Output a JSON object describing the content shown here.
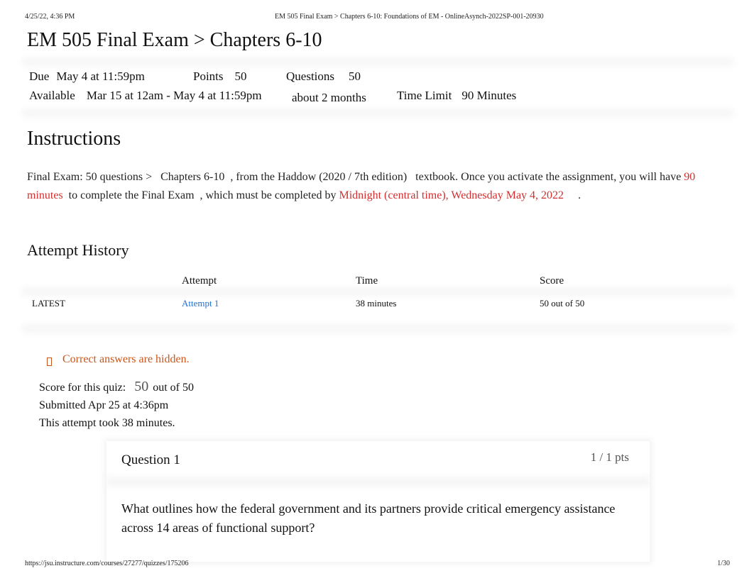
{
  "print_header": {
    "datetime": "4/25/22, 4:36 PM",
    "page_title": "EM 505 Final Exam > Chapters 6-10: Foundations of EM - OnlineAsynch-2022SP-001-20930"
  },
  "title": "EM 505 Final Exam > Chapters 6-10",
  "details": {
    "due_label": "Due",
    "due_value": "May 4 at 11:59pm",
    "points_label": "Points",
    "points_value": "50",
    "questions_label": "Questions",
    "questions_value": "50",
    "available_label": "Available",
    "available_value": "Mar 15 at 12am - May 4 at 11:59pm",
    "available_duration": "about 2 months",
    "time_limit_label": "Time Limit",
    "time_limit_value": "90 Minutes"
  },
  "instructions": {
    "heading": "Instructions",
    "line1_a": "Final Exam: 50 questions >   Chapters 6-10  , from the Haddow (2020 / 7th edition)   textbook. Once you activate the assignment, you will have ",
    "line1_red": "90",
    "line2_red_a": "minutes",
    "line2_b": "  to complete the Final Exam  , which must be completed by ",
    "line2_red_b": "Midnight (central time), Wednesday May 4, 2022",
    "line2_end": "     ."
  },
  "attempt_history": {
    "heading": "Attempt History",
    "columns": [
      "",
      "Attempt",
      "Time",
      "Score"
    ],
    "rows": [
      {
        "tag": "LATEST",
        "attempt": "Attempt 1",
        "time": "38 minutes",
        "score": "50 out of 50"
      }
    ]
  },
  "result": {
    "warning_icon": "warning-icon",
    "warning": "Correct answers are hidden.",
    "score_label": "Score for this quiz:",
    "score_value": "50",
    "score_out_of": "out of 50",
    "submitted": "Submitted Apr 25 at 4:36pm",
    "duration": "This attempt took 38 minutes."
  },
  "question": {
    "title": "Question 1",
    "points": "1 / 1 pts",
    "text": "What outlines how the federal government and its partners provide critical emergency assistance across 14 areas of functional support?"
  },
  "footer": {
    "url": "https://jsu.instructure.com/courses/27277/quizzes/175206",
    "page": "1/30"
  },
  "colors": {
    "accent_red": "#d12f2f",
    "link_blue": "#1f6fd1",
    "warning_orange": "#c9561a"
  }
}
